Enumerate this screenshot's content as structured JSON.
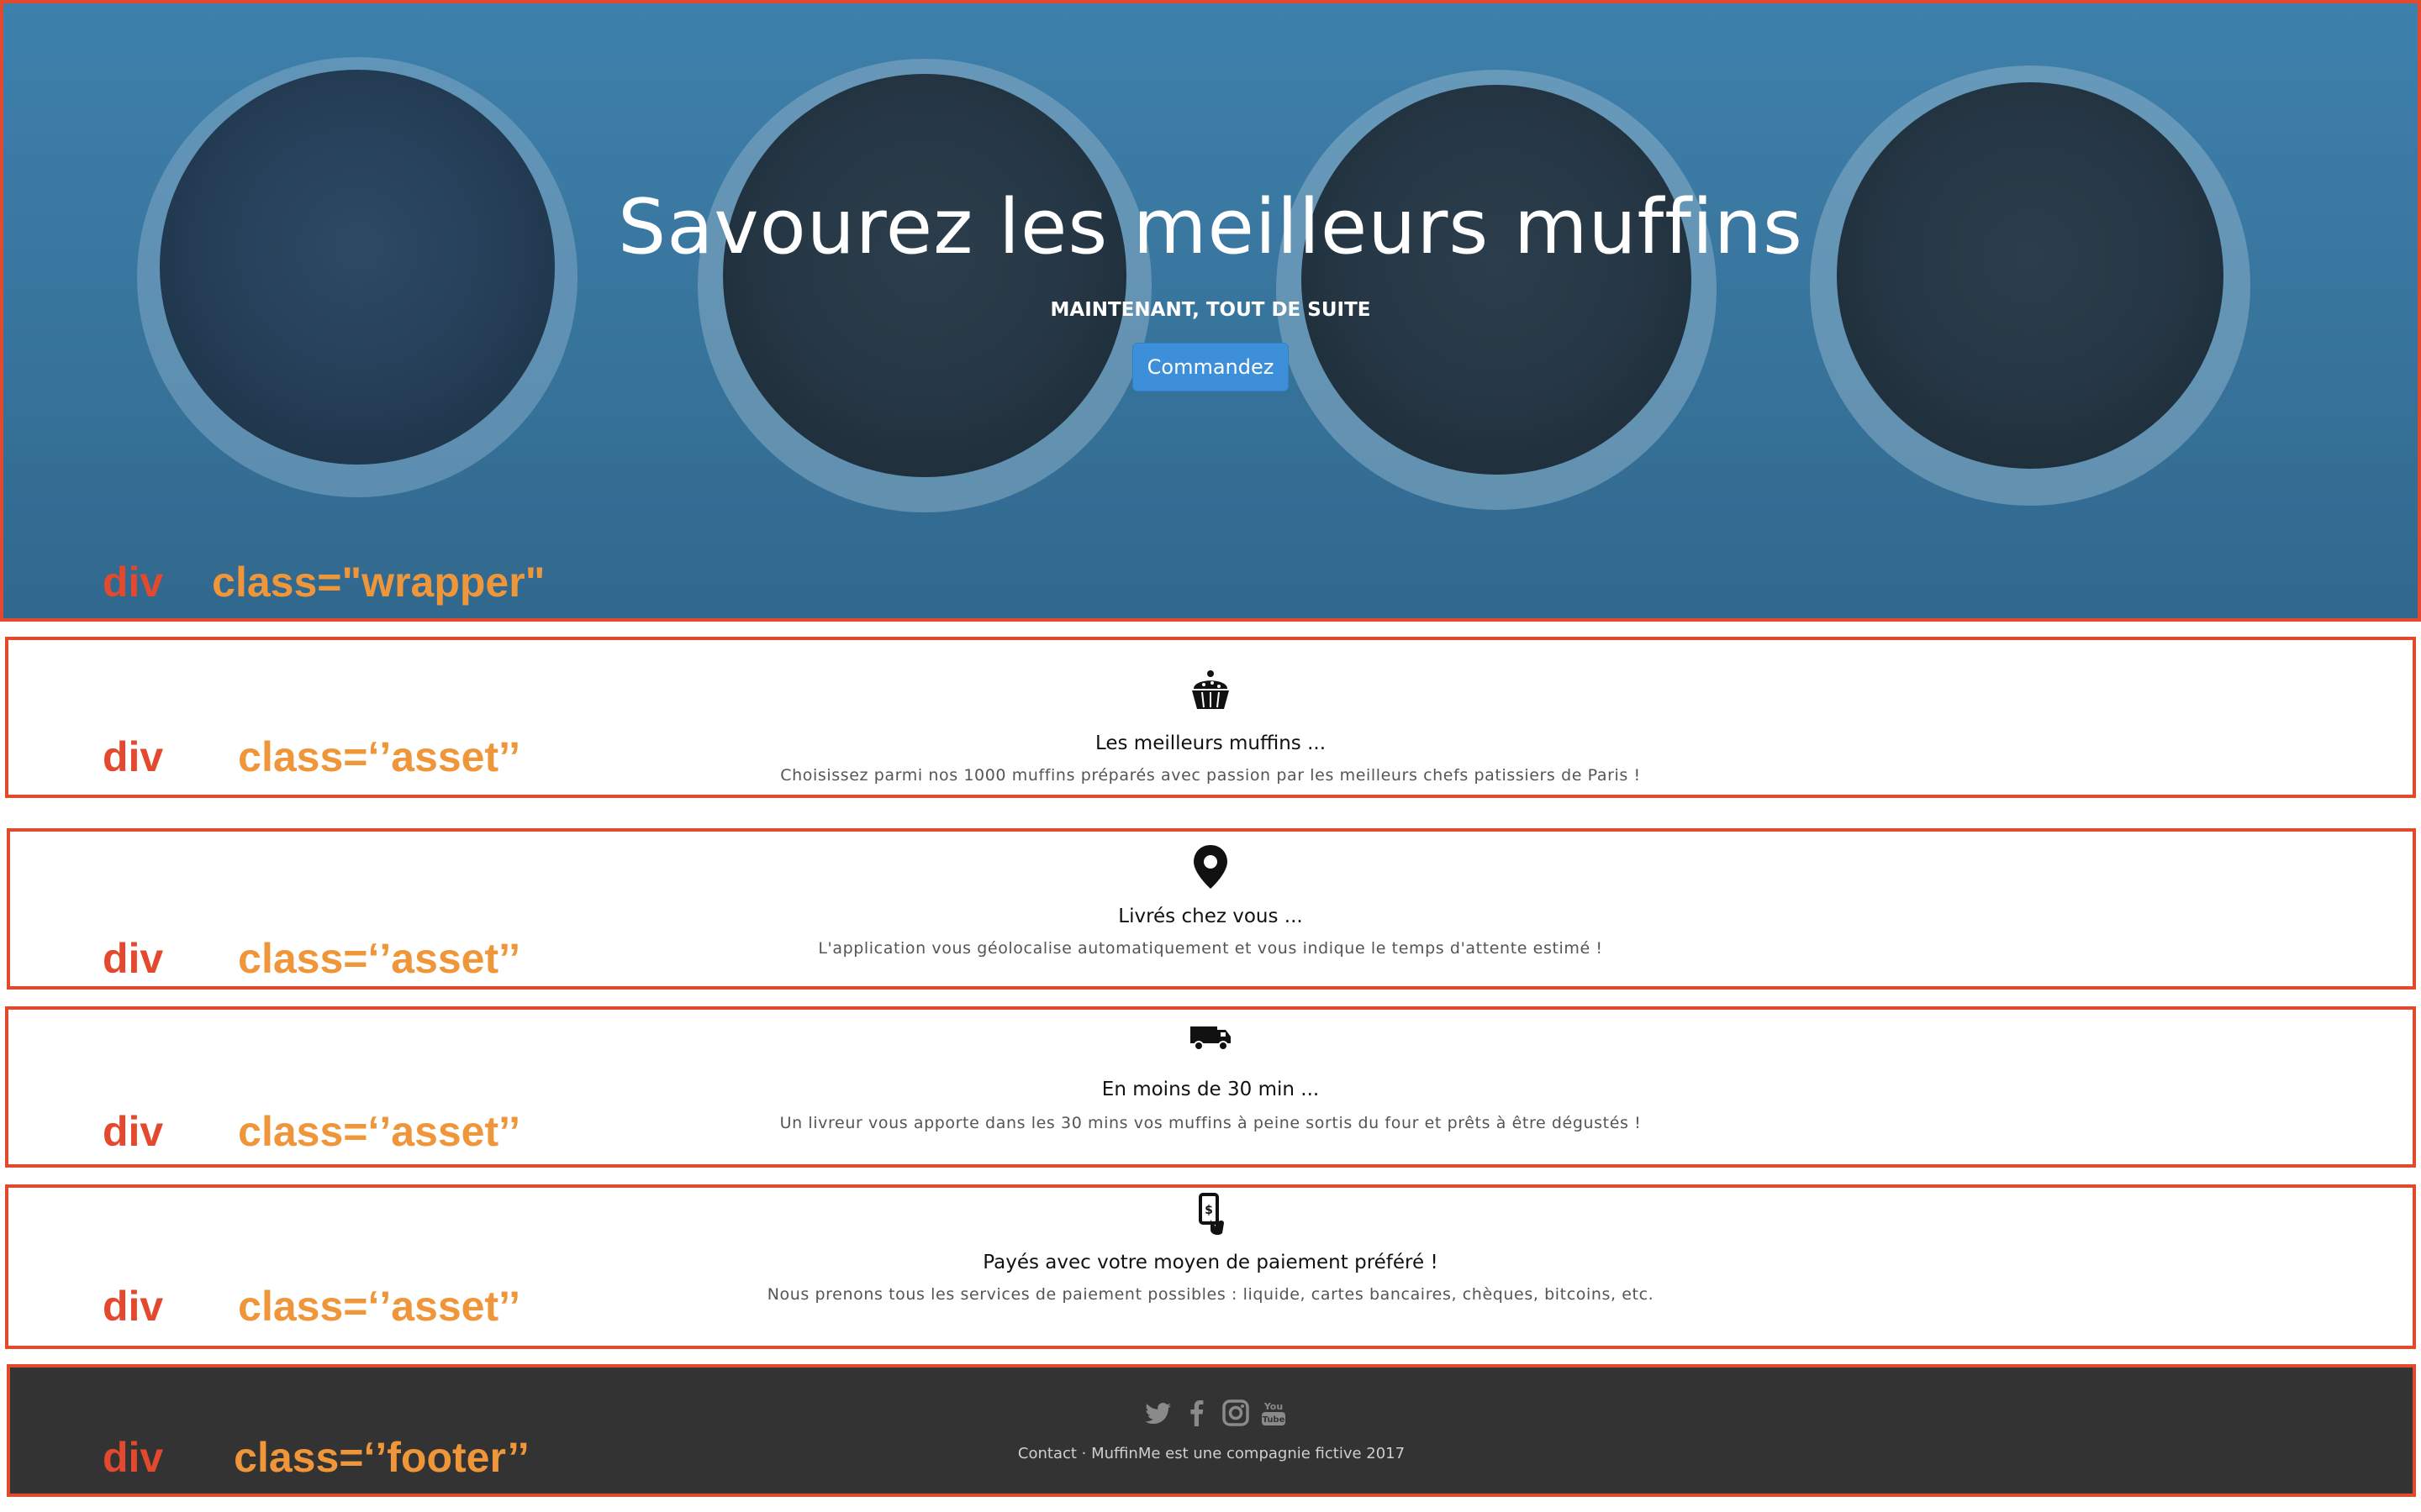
{
  "hero": {
    "title": "Savourez les meilleurs muffins",
    "subtitle": "MAINTENANT, TOUT DE SUITE",
    "button_label": "Commandez",
    "annotation_tag": "div",
    "annotation_class": "class=\"wrapper\""
  },
  "assets": [
    {
      "icon": "cupcake-icon",
      "title": "Les meilleurs muffins ...",
      "text": "Choisissez parmi nos 1000 muffins préparés avec passion par les meilleurs chefs patissiers de Paris !",
      "annotation_tag": "div",
      "annotation_class": "class=‘’asset’’"
    },
    {
      "icon": "map-marker-icon",
      "title": "Livrés chez vous ...",
      "text": "L'application vous géolocalise automatiquement et vous indique le temps d'attente estimé !",
      "annotation_tag": "div",
      "annotation_class": "class=‘’asset’’"
    },
    {
      "icon": "delivery-truck-icon",
      "title": "En moins de 30 min ...",
      "text": "Un livreur vous apporte dans les 30 mins vos muffins à peine sortis du four et prêts à être dégustés !",
      "annotation_tag": "div",
      "annotation_class": "class=‘’asset’’"
    },
    {
      "icon": "mobile-payment-icon",
      "title": "Payés avec votre moyen de paiement préféré !",
      "text": "Nous prenons tous les services de paiement possibles : liquide, cartes bancaires, chèques, bitcoins, etc.",
      "annotation_tag": "div",
      "annotation_class": "class=‘’asset’’"
    }
  ],
  "footer": {
    "social_icons": [
      "twitter-icon",
      "facebook-icon",
      "instagram-icon",
      "youtube-icon"
    ],
    "text": "Contact · MuffinMe est une compagnie fictive 2017",
    "annotation_tag": "div",
    "annotation_class": "class=‘’footer’’"
  },
  "colors": {
    "annotation_outline": "#e2492e",
    "annotation_tag": "#e2492e",
    "annotation_class": "#f0963a",
    "button": "#3d8fd9",
    "footer_bg": "#333333",
    "hero_overlay": "#3a769e"
  }
}
